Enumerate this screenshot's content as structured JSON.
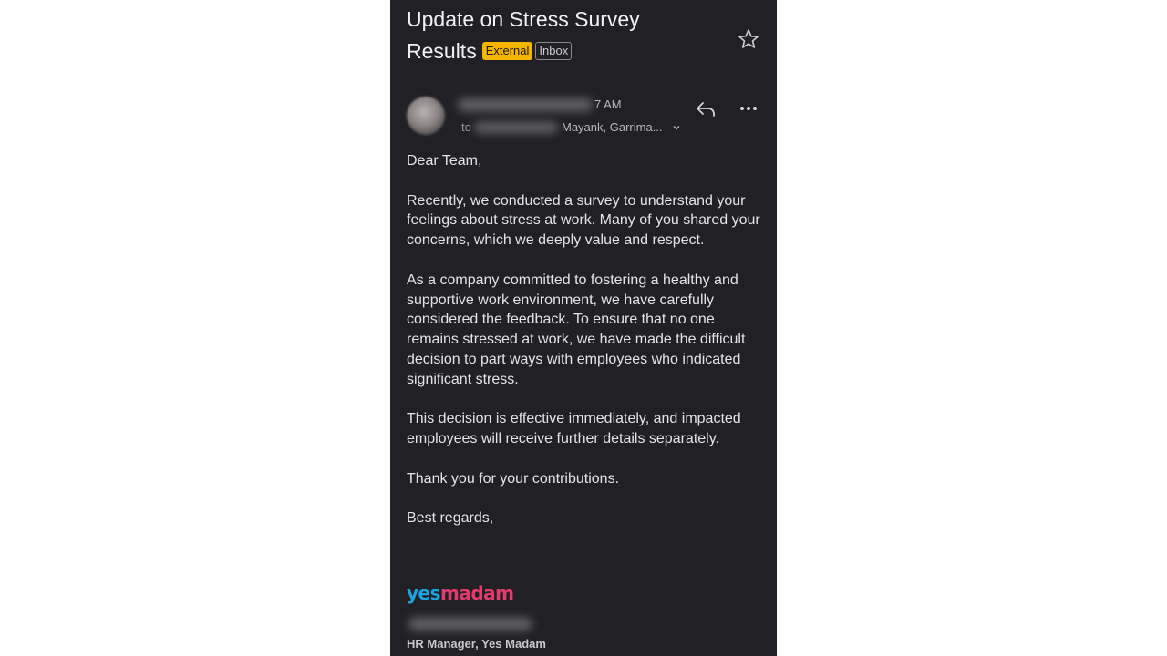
{
  "email": {
    "subject": "Update on Stress Survey Results",
    "labels": {
      "external": "External",
      "inbox": "Inbox"
    },
    "header": {
      "time_partial": "7 AM",
      "to_prefix": "to",
      "recipients_visible": "Mayank, Garrima...",
      "icons": [
        "star-icon",
        "reply-icon",
        "more-options-icon",
        "chevron-down-icon"
      ]
    },
    "body": [
      "Dear Team,",
      "Recently, we conducted a survey to understand your feelings about stress at work. Many of you shared your concerns, which we deeply value and respect.",
      "As a company committed to fostering a healthy and supportive work environment, we have carefully considered the feedback. To ensure that no one remains stressed at work, we have made the difficult decision to part ways with employees who indicated significant stress.",
      "This decision is effective immediately, and impacted employees will receive further details separately.",
      "Thank you for your contributions.",
      "Best regards,"
    ],
    "signature": {
      "logo_yes": "yes",
      "logo_madam": "madam",
      "title": "HR Manager, Yes Madam"
    }
  },
  "colors": {
    "background": "#212125",
    "external_label": "#f5b400",
    "logo_blue": "#1aa3e0",
    "logo_pink": "#e43b6f"
  }
}
